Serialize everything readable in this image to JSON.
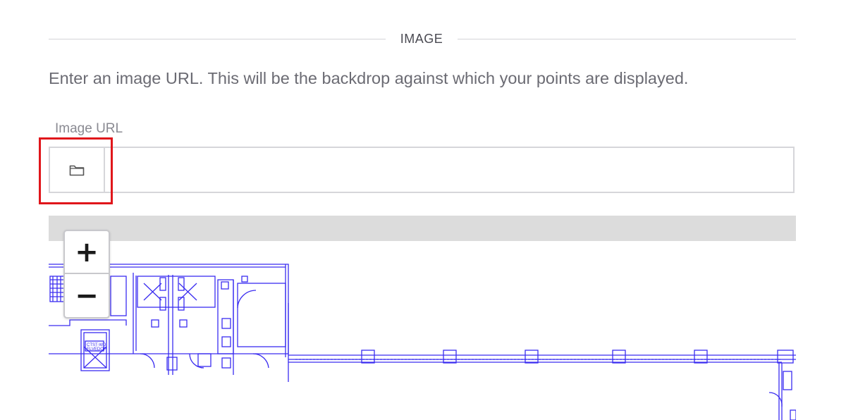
{
  "section": {
    "title": "IMAGE"
  },
  "description": "Enter an image URL. This will be the backdrop against which your points are displayed.",
  "image_url": {
    "label": "Image URL",
    "value": "",
    "browse_icon": "folder-icon"
  },
  "map": {
    "zoom_in": "+",
    "zoom_out": "−",
    "floorplan_tag": "CTST-WD\nELVEDOP"
  },
  "colors": {
    "highlight": "#e0161b",
    "floorplan_line": "#3a2cf0",
    "toolbar": "#dcdcdc"
  }
}
